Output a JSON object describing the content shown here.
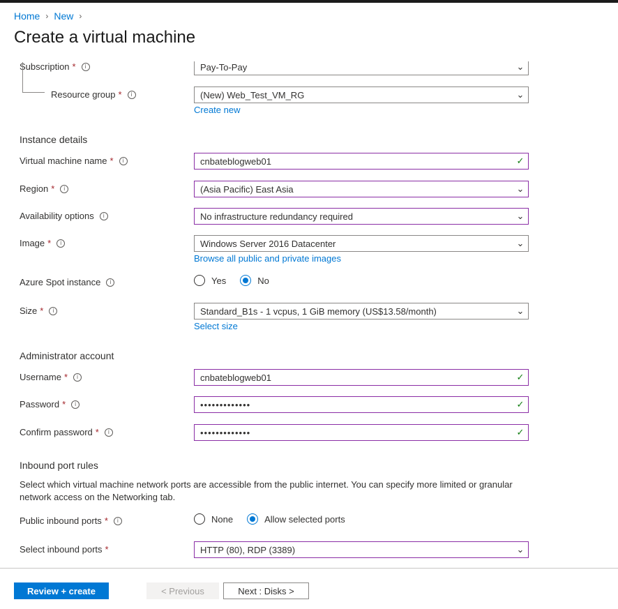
{
  "breadcrumb": {
    "home": "Home",
    "new": "New"
  },
  "page_title": "Create a virtual machine",
  "project": {
    "subscription_label": "Subscription",
    "subscription_value": "Pay-To-Pay",
    "resource_group_label": "Resource group",
    "resource_group_value": "(New) Web_Test_VM_RG",
    "create_new_link": "Create new"
  },
  "instance": {
    "heading": "Instance details",
    "vm_name_label": "Virtual machine name",
    "vm_name_value": "cnbateblogweb01",
    "region_label": "Region",
    "region_value": "(Asia Pacific) East Asia",
    "availability_label": "Availability options",
    "availability_value": "No infrastructure redundancy required",
    "image_label": "Image",
    "image_value": "Windows Server 2016 Datacenter",
    "image_link": "Browse all public and private images",
    "spot_label": "Azure Spot instance",
    "spot_yes": "Yes",
    "spot_no": "No",
    "size_label": "Size",
    "size_value": "Standard_B1s - 1 vcpus, 1 GiB memory (US$13.58/month)",
    "size_link": "Select size"
  },
  "admin": {
    "heading": "Administrator account",
    "username_label": "Username",
    "username_value": "cnbateblogweb01",
    "password_label": "Password",
    "password_value": "•••••••••••••",
    "confirm_label": "Confirm password",
    "confirm_value": "•••••••••••••"
  },
  "inbound": {
    "heading": "Inbound port rules",
    "description": "Select which virtual machine network ports are accessible from the public internet. You can specify more limited or granular network access on the Networking tab.",
    "public_label": "Public inbound ports",
    "option_none": "None",
    "option_allow": "Allow selected ports",
    "select_label": "Select inbound ports",
    "select_value": "HTTP (80), RDP (3389)"
  },
  "footer": {
    "review_create": "Review + create",
    "previous": "< Previous",
    "next": "Next : Disks >"
  },
  "colors": {
    "accent": "#0078d4",
    "active_border": "#8a2da5",
    "valid": "#107c10",
    "required": "#a4262c"
  }
}
